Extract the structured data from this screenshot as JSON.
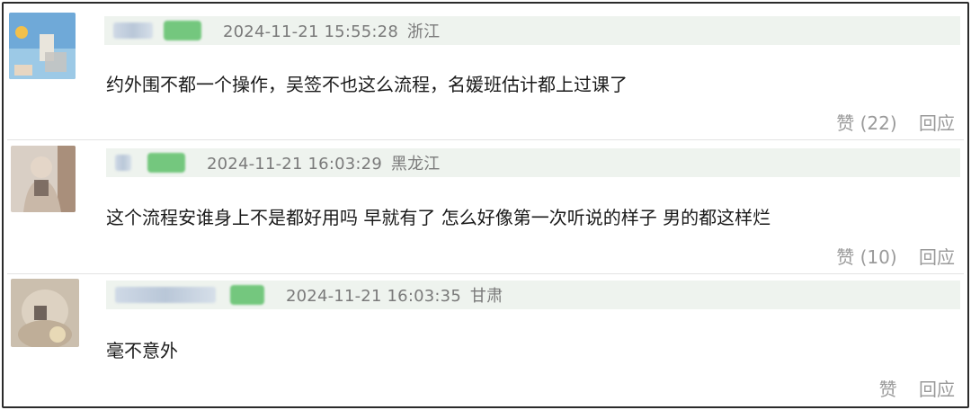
{
  "comments": [
    {
      "timestamp": "2024-11-21 15:55:28",
      "location": "浙江",
      "text": "约外围不都一个操作，吴签不也这么流程，名媛班估计都上过课了",
      "like_label": "赞 (22)",
      "reply_label": "回应"
    },
    {
      "timestamp": "2024-11-21 16:03:29",
      "location": "黑龙江",
      "text": "这个流程安谁身上不是都好用吗 早就有了 怎么好像第一次听说的样子 男的都这样烂",
      "like_label": "赞 (10)",
      "reply_label": "回应"
    },
    {
      "timestamp": "2024-11-21 16:03:35",
      "location": "甘肃",
      "text": "毫不意外",
      "like_label": "赞",
      "reply_label": "回应"
    }
  ],
  "colors": {
    "meta_bg": "#eef3ee",
    "meta_text": "#7a7a7a",
    "action_text": "#9a9a9a",
    "badge": "#74c77e"
  }
}
